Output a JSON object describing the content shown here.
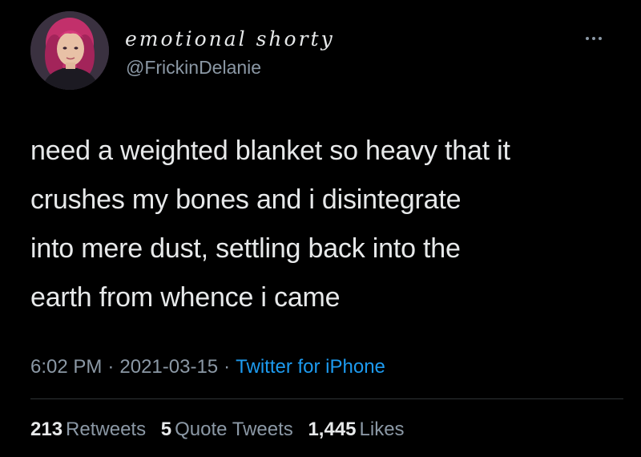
{
  "tweet": {
    "author": {
      "display_name": "emotional shorty",
      "handle": "@FrickinDelanie",
      "avatar_icon": "profile-avatar"
    },
    "more_icon": "more-dots-icon",
    "text_lines": [
      "need a weighted blanket so heavy that it",
      "crushes my bones and i disintegrate",
      "into mere dust, settling back into the",
      "earth from whence i came"
    ],
    "time": "6:02 PM",
    "date": "2021-03-15",
    "source": "Twitter for iPhone",
    "stats": {
      "retweets_count": "213",
      "retweets_label": "Retweets",
      "quotes_count": "5",
      "quotes_label": "Quote Tweets",
      "likes_count": "1,445",
      "likes_label": "Likes"
    }
  },
  "colors": {
    "background": "#000000",
    "text": "#e7e9ea",
    "secondary": "#8b98a5",
    "accent": "#1d9bf0"
  }
}
